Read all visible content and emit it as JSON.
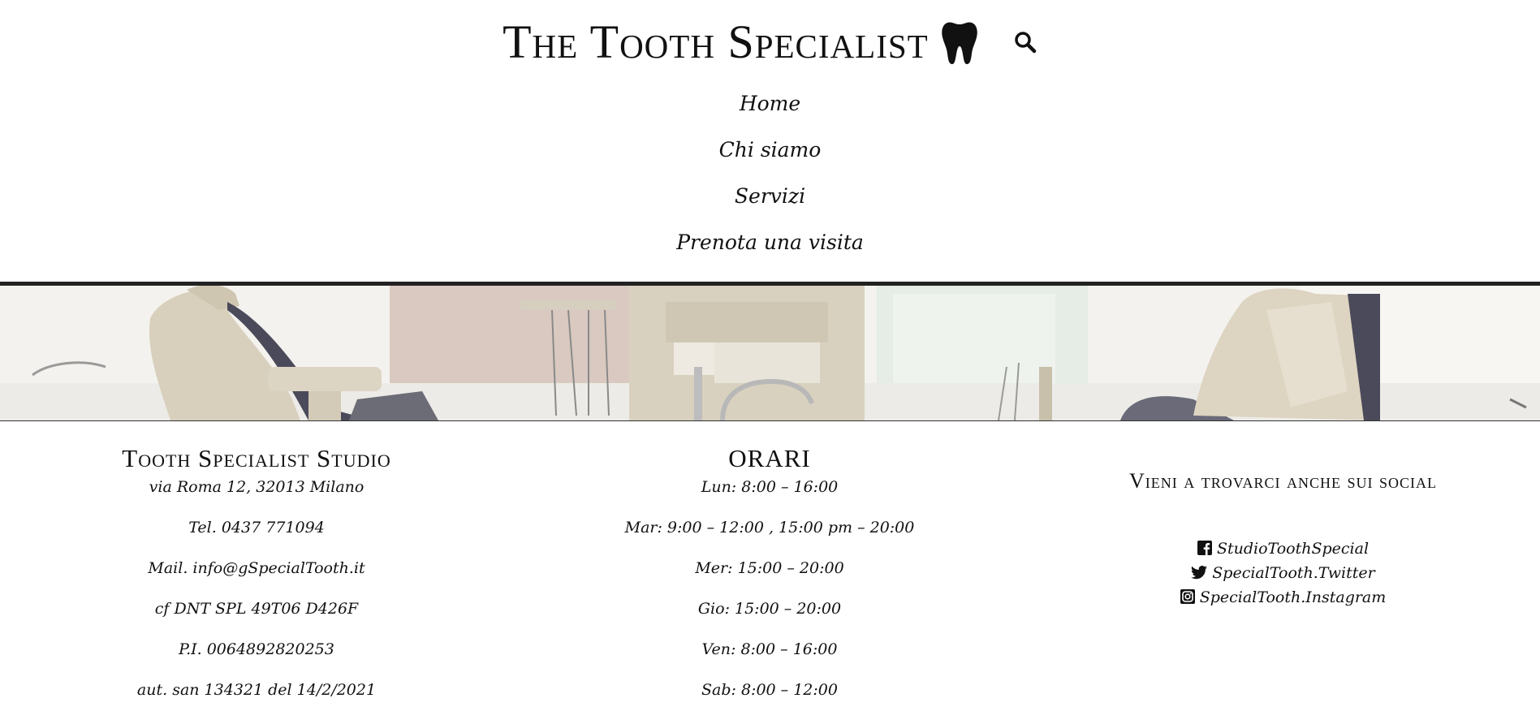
{
  "header": {
    "title": "The Tooth Specialist",
    "logo_icon": "tooth-icon",
    "search_icon": "search-icon"
  },
  "nav": {
    "items": [
      {
        "label": "Home"
      },
      {
        "label": "Chi siamo"
      },
      {
        "label": "Servizi"
      },
      {
        "label": "Prenota una visita"
      }
    ]
  },
  "hero": {
    "image": "dental-office-banner"
  },
  "studio": {
    "title": "Tooth Specialist Studio",
    "lines": [
      "via Roma 12, 32013 Milano",
      "Tel. 0437 771094",
      "Mail. info@gSpecialTooth.it",
      "cf DNT SPL 49T06 D426F",
      "P.I. 0064892820253",
      "aut. san 134321 del 14/2/2021"
    ]
  },
  "hours": {
    "title": "ORARI",
    "lines": [
      "Lun: 8:00 – 16:00",
      "Mar: 9:00 – 12:00 , 15:00 pm – 20:00",
      "Mer: 15:00 – 20:00",
      "Gio: 15:00 – 20:00",
      "Ven: 8:00 – 16:00",
      "Sab: 8:00 – 12:00"
    ]
  },
  "social": {
    "title": "Vieni a trovarci anche sui social",
    "items": [
      {
        "icon": "facebook-icon",
        "label": "StudioToothSpecial"
      },
      {
        "icon": "twitter-icon",
        "label": "SpecialTooth.Twitter"
      },
      {
        "icon": "instagram-icon",
        "label": "SpecialTooth.Instagram"
      }
    ]
  },
  "colors": {
    "text": "#111111",
    "background": "#ffffff",
    "rule": "#222222"
  }
}
